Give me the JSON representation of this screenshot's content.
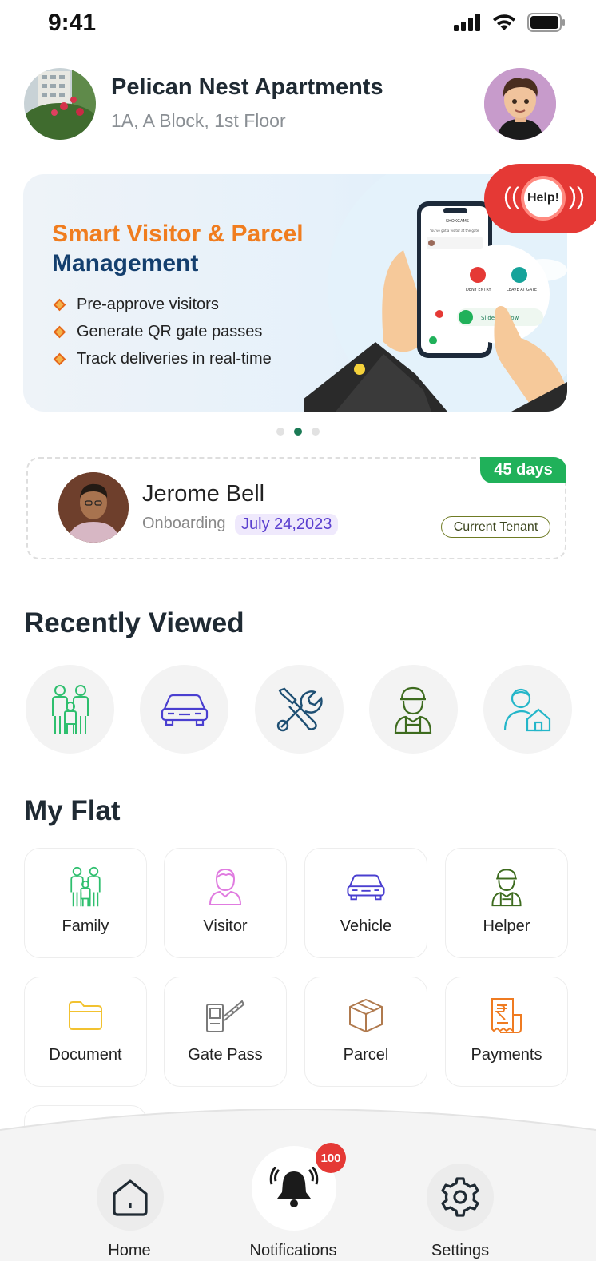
{
  "status_bar": {
    "time": "9:41"
  },
  "header": {
    "apartment_name": "Pelican Nest Apartments",
    "address": "1A, A Block, 1st Floor"
  },
  "banner": {
    "title_line1": "Smart Visitor & Parcel",
    "title_line2": "Management",
    "bullets": [
      "Pre-approve visitors",
      "Generate QR gate passes",
      "Track deliveries in real-time"
    ],
    "phone_brand": "SHOKGAMS",
    "phone_message": "You've got a visitor at the gate",
    "phone_deny": "DENY ENTRY",
    "phone_leave": "LEAVE AT GATE",
    "phone_slide": "Slide to Allow",
    "slides_total": 3,
    "active_slide": 2
  },
  "help": {
    "label": "Help!"
  },
  "tenant": {
    "name": "Jerome Bell",
    "onboarding_label": "Onboarding",
    "onboarding_date": "July 24,2023",
    "days": "45 days",
    "status": "Current Tenant"
  },
  "recently_viewed": {
    "title": "Recently Viewed",
    "items": [
      {
        "icon": "family-icon"
      },
      {
        "icon": "car-icon"
      },
      {
        "icon": "tools-icon"
      },
      {
        "icon": "helper-icon"
      },
      {
        "icon": "home-owner-icon"
      }
    ]
  },
  "my_flat": {
    "title": "My Flat",
    "tiles": [
      {
        "label": "Family",
        "icon": "family-icon"
      },
      {
        "label": "Visitor",
        "icon": "visitor-icon"
      },
      {
        "label": "Vehicle",
        "icon": "car-icon"
      },
      {
        "label": "Helper",
        "icon": "helper-icon"
      },
      {
        "label": "Document",
        "icon": "folder-icon"
      },
      {
        "label": "Gate Pass",
        "icon": "gate-icon"
      },
      {
        "label": "Parcel",
        "icon": "parcel-icon"
      },
      {
        "label": "Payments",
        "icon": "receipt-icon"
      }
    ]
  },
  "bottom_nav": {
    "home": "Home",
    "notifications": "Notifications",
    "notifications_badge": "100",
    "settings": "Settings"
  },
  "colors": {
    "accent_orange": "#f07d1f",
    "banner_navy": "#143f6e",
    "green": "#20b15a",
    "help_red": "#e53935"
  }
}
